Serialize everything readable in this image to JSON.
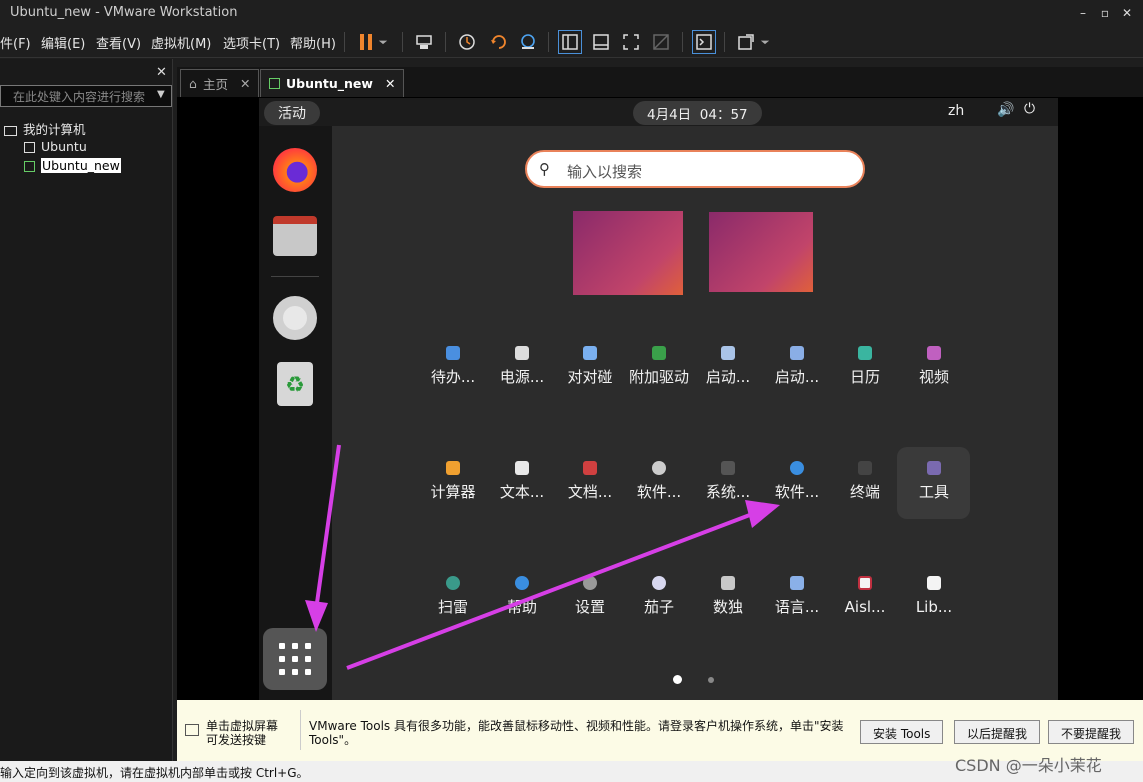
{
  "window": {
    "title": "Ubuntu_new - VMware Workstation"
  },
  "menu": [
    "件(F)",
    "编辑(E)",
    "查看(V)",
    "虚拟机(M)",
    "选项卡(T)",
    "帮助(H)"
  ],
  "library": {
    "search_placeholder": "在此处键入内容进行搜索",
    "root": "我的计算机",
    "vms": [
      "Ubuntu",
      "Ubuntu_new"
    ]
  },
  "tabs": {
    "home": "主页",
    "vm": "Ubuntu_new"
  },
  "ubuntu": {
    "activities": "活动",
    "clock": "4月4日  04：57",
    "lang": "zh",
    "search_placeholder": "输入以搜索",
    "apps_row1": [
      "待办...",
      "电源...",
      "对对碰",
      "附加驱动",
      "启动...",
      "启动...",
      "日历",
      "视频"
    ],
    "apps_row2": [
      "计算器",
      "文本...",
      "文档...",
      "软件...",
      "系统...",
      "软件...",
      "终端",
      "工具"
    ],
    "apps_row3": [
      "扫雷",
      "帮助",
      "设置",
      "茄子",
      "数独",
      "语言...",
      "Aisl...",
      "Lib..."
    ]
  },
  "notification": {
    "left_line1": "单击虚拟屏幕",
    "left_line2": "可发送按键",
    "message_line1": "VMware Tools 具有很多功能，能改善鼠标移动性、视频和性能。请登录客户机操作系统，单击\"安装",
    "message_line2": "Tools\"。",
    "btn_install": "安装 Tools",
    "btn_later": "以后提醒我",
    "btn_never": "不要提醒我"
  },
  "statusbar": {
    "text": "输入定向到该虚拟机，请在虚拟机内部单击或按 Ctrl+G。"
  },
  "watermark": "CSDN @一朵小茉花",
  "colors": {
    "accent": "#e9825a",
    "arrow": "#d63fe6",
    "wallpaper": "#b8386a"
  }
}
